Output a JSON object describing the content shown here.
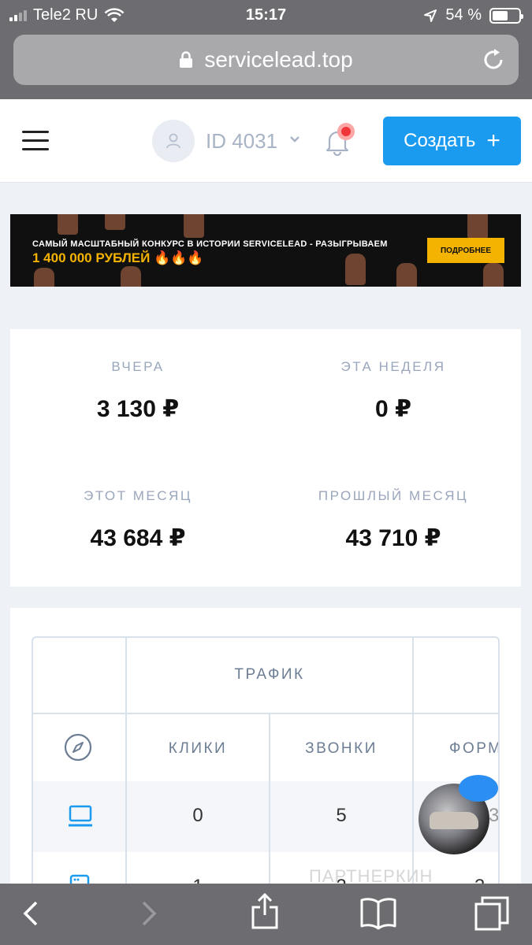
{
  "status_bar": {
    "carrier": "Tele2 RU",
    "time": "15:17",
    "battery": "54 %"
  },
  "browser": {
    "url": "servicelead.top"
  },
  "header": {
    "user_id": "ID 4031",
    "create_label": "Создать",
    "create_icon": "plus-icon"
  },
  "banner": {
    "line1": "САМЫЙ МАСШТАБНЫЙ КОНКУРС В ИСТОРИИ SERVICELEAD - РАЗЫГРЫВАЕМ",
    "line2": "1 400 000 РУБЛЕЙ 🔥🔥🔥",
    "button": "ПОДРОБНЕЕ"
  },
  "stats": [
    {
      "label": "ВЧЕРА",
      "value": "3 130 ₽"
    },
    {
      "label": "ЭТА НЕДЕЛЯ",
      "value": "0 ₽"
    },
    {
      "label": "ЭТОТ МЕСЯЦ",
      "value": "43 684 ₽"
    },
    {
      "label": "ПРОШЛЫЙ МЕСЯЦ",
      "value": "43 710 ₽"
    }
  ],
  "table": {
    "group_header": "ТРАФИК",
    "columns": [
      "КЛИКИ",
      "ЗВОНКИ",
      "ФОРМ"
    ],
    "rows": [
      {
        "icon": "desktop-icon",
        "cells": [
          "0",
          "5",
          "3"
        ]
      },
      {
        "icon": "browser-window-icon",
        "cells": [
          "1",
          "2",
          "3"
        ]
      }
    ]
  },
  "watermark": "ПАРТНЕРКИН",
  "colors": {
    "accent": "#1a9bf0",
    "label_gray": "#9aa6bc",
    "notification": "#f0353a"
  }
}
